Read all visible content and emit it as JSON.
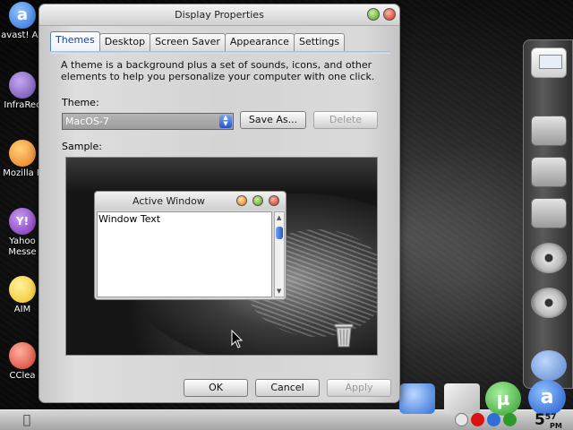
{
  "window": {
    "title": "Display Properties",
    "tabs": [
      "Themes",
      "Desktop",
      "Screen Saver",
      "Appearance",
      "Settings"
    ],
    "active_tab": "Themes",
    "description": "A theme is a background plus a set of sounds, icons, and other elements to help you personalize your computer with one click.",
    "theme_label": "Theme:",
    "theme_value": "MacOS-7",
    "save_as_label": "Save As...",
    "delete_label": "Delete",
    "sample_label": "Sample:",
    "preview": {
      "title": "Active Window",
      "text": "Window Text"
    },
    "ok_label": "OK",
    "cancel_label": "Cancel",
    "apply_label": "Apply"
  },
  "desktop_icons": [
    {
      "label": "avast! An",
      "color": "#2f6fd6"
    },
    {
      "label": "InfraRec",
      "color": "#6b4aa8"
    },
    {
      "label": "Mozilla F",
      "color": "#e8761f"
    },
    {
      "label": "Yahoo Messe",
      "color": "#7b2ab6"
    },
    {
      "label": "AIM",
      "color": "#f2c21b"
    },
    {
      "label": "CClea",
      "color": "#d43b2a"
    }
  ],
  "taskbar": {
    "clock_hour": "5",
    "clock_minutes": "57",
    "clock_ampm": "PM"
  }
}
